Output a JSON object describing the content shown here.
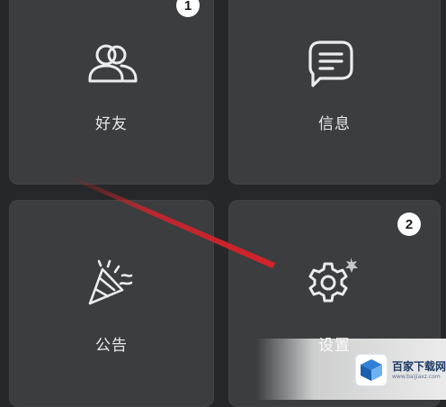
{
  "tiles": {
    "friends": {
      "label": "好友",
      "icon": "friends-icon",
      "badge": "1"
    },
    "messages": {
      "label": "信息",
      "icon": "message-icon"
    },
    "announcements": {
      "label": "公告",
      "icon": "party-popper-icon"
    },
    "settings": {
      "label": "设置",
      "icon": "gear-icon",
      "badge": "2"
    }
  },
  "annotation": {
    "color": "#d4232b"
  },
  "colors": {
    "background": "#262728",
    "tile": "#3b3d3f",
    "text": "#e9e9e9"
  }
}
